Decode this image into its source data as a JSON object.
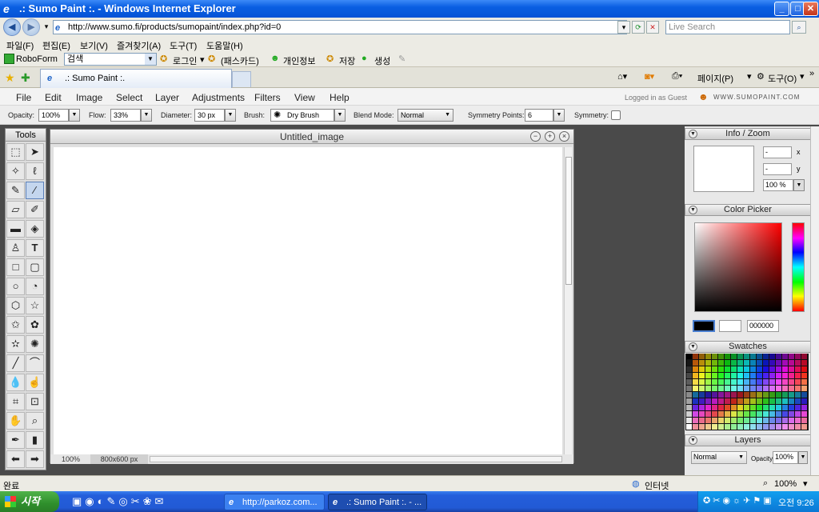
{
  "window": {
    "title": ".: Sumo Paint :. - Windows Internet Explorer",
    "min_label": "_",
    "max_label": "□",
    "close_label": "✕"
  },
  "addressbar": {
    "url": "http://www.sumo.fi/products/sumopaint/index.php?id=0",
    "search_placeholder": "Live Search"
  },
  "ie_menu": [
    "파일(F)",
    "편집(E)",
    "보기(V)",
    "즐겨찾기(A)",
    "도구(T)",
    "도움말(H)"
  ],
  "roboform": {
    "label": "RoboForm",
    "search_value": "검색",
    "items": [
      "로그인",
      "(패스카드)",
      "개인정보",
      "저장",
      "생성"
    ]
  },
  "tabbar": {
    "tab_title": ".: Sumo Paint :.",
    "tools_right": [
      "페이지(P)",
      "도구(O)"
    ]
  },
  "sumo_menu": {
    "items": [
      "File",
      "Edit",
      "Image",
      "Select",
      "Layer",
      "Adjustments",
      "Filters",
      "View",
      "Help"
    ],
    "login_status": "Logged in as Guest",
    "brand": "WWW.SUMOPAINT.COM"
  },
  "options": {
    "opacity_label": "Opacity:",
    "opacity_value": "100%",
    "flow_label": "Flow:",
    "flow_value": "33%",
    "diameter_label": "Diameter:",
    "diameter_value": "30 px",
    "brush_label": "Brush:",
    "brush_value": "Dry Brush",
    "blend_label": "Blend Mode:",
    "blend_value": "Normal",
    "sympoints_label": "Symmetry Points:",
    "sympoints_value": "6",
    "symmetry_label": "Symmetry:"
  },
  "tools_panel": {
    "title": "Tools"
  },
  "canvas": {
    "title": "Untitled_image",
    "zoom": "100%",
    "size": "800x600 px"
  },
  "info_panel": {
    "title": "Info / Zoom",
    "x_value": "-",
    "y_value": "-",
    "x_label": "x",
    "y_label": "y",
    "zoom_value": "100 %"
  },
  "color_picker": {
    "title": "Color Picker",
    "hex_value": "000000",
    "fg_color": "#000000",
    "bg_color": "#ffffff"
  },
  "swatches": {
    "title": "Swatches"
  },
  "layers": {
    "title": "Layers",
    "blend_value": "Normal",
    "opacity_label": "Opacity:",
    "opacity_value": "100%"
  },
  "ie_status": {
    "left": "완료",
    "zone": "인터넷",
    "zoom": "100%"
  },
  "taskbar": {
    "start_label": "시작",
    "items": [
      "http://parkoz.com...",
      ".: Sumo Paint :. - ..."
    ],
    "clock": "오전 9:26"
  }
}
